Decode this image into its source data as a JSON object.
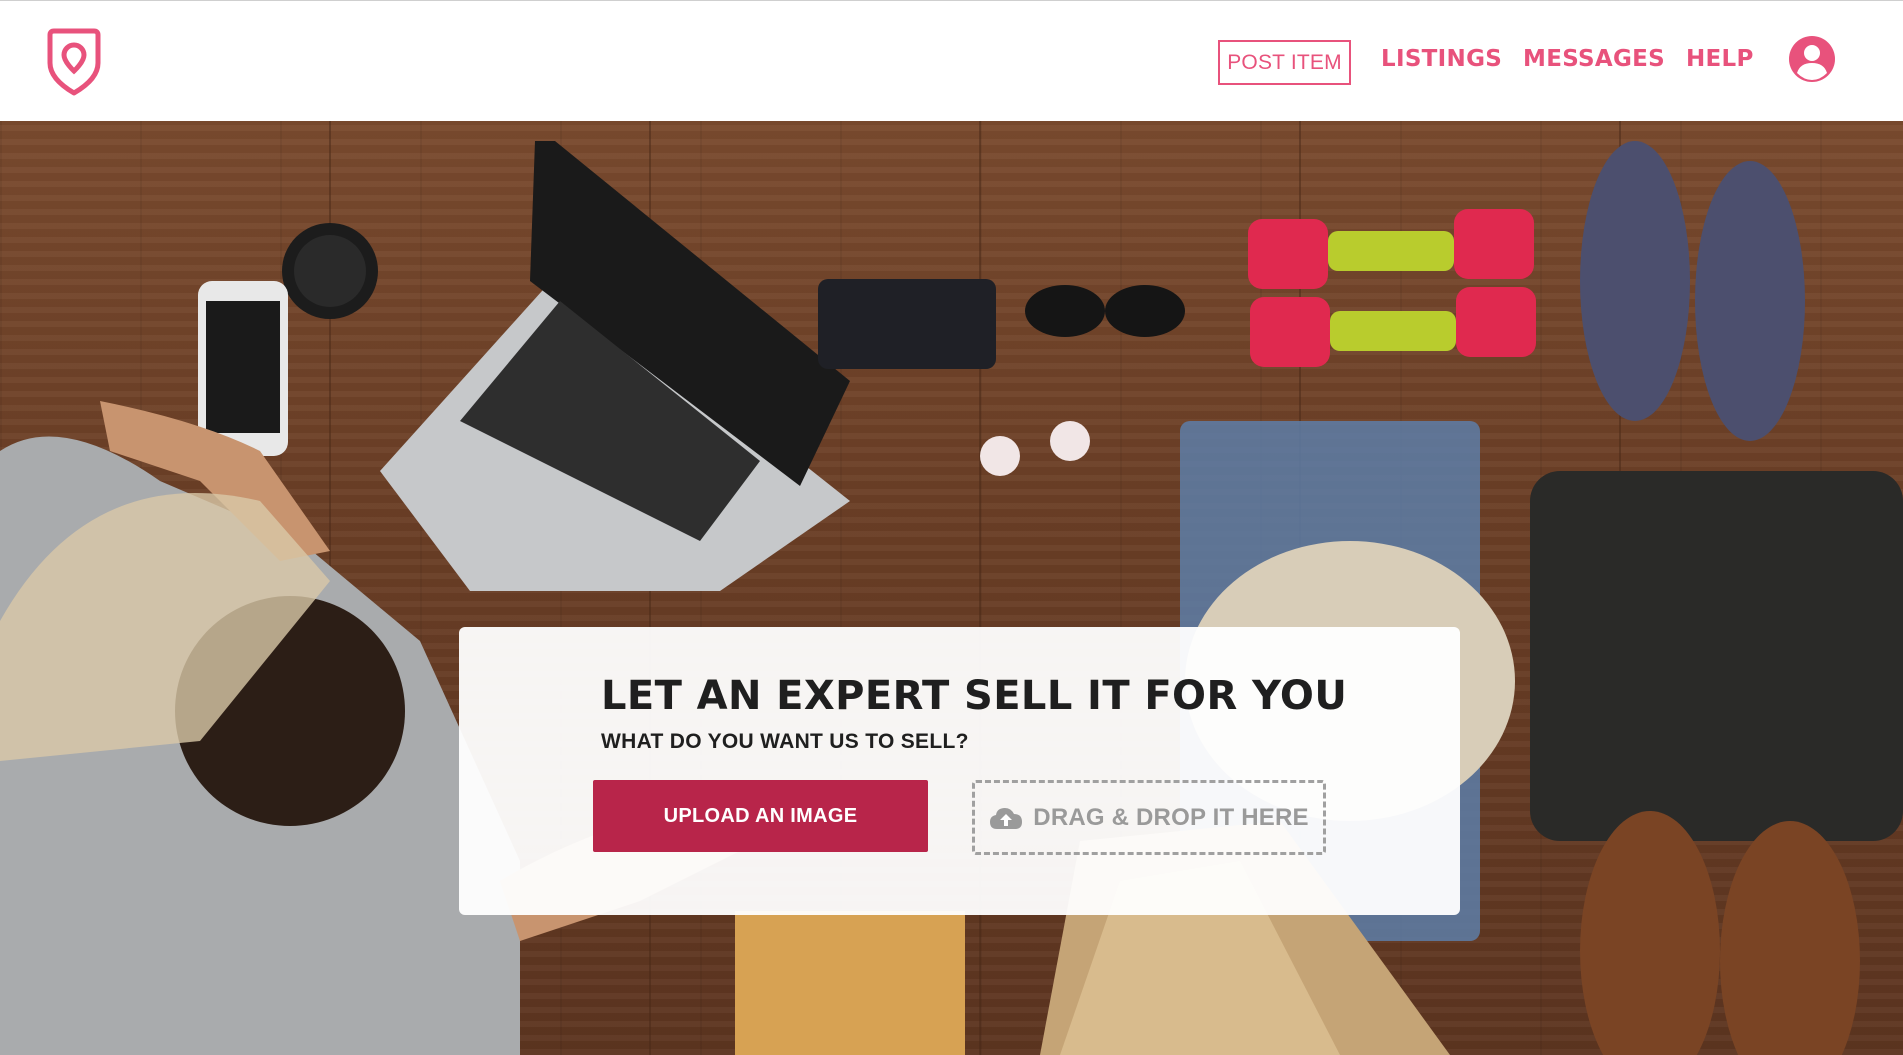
{
  "header": {
    "logo_icon": "location-shield-icon",
    "post_item_label": "POST ITEM",
    "nav": [
      {
        "label": "LISTINGS"
      },
      {
        "label": "MESSAGES"
      },
      {
        "label": "HELP"
      }
    ],
    "account_icon": "user-circle-icon",
    "accent_color": "#e8527c"
  },
  "hero": {
    "background": "photo of person packing items on wooden floor",
    "card": {
      "title": "LET AN EXPERT SELL IT FOR YOU",
      "subtitle": "WHAT DO YOU WANT US TO SELL?",
      "upload_label": "UPLOAD AN IMAGE",
      "upload_color": "#b8254a",
      "dropzone_label": "DRAG & DROP IT HERE",
      "dropzone_icon": "cloud-upload-icon"
    }
  }
}
